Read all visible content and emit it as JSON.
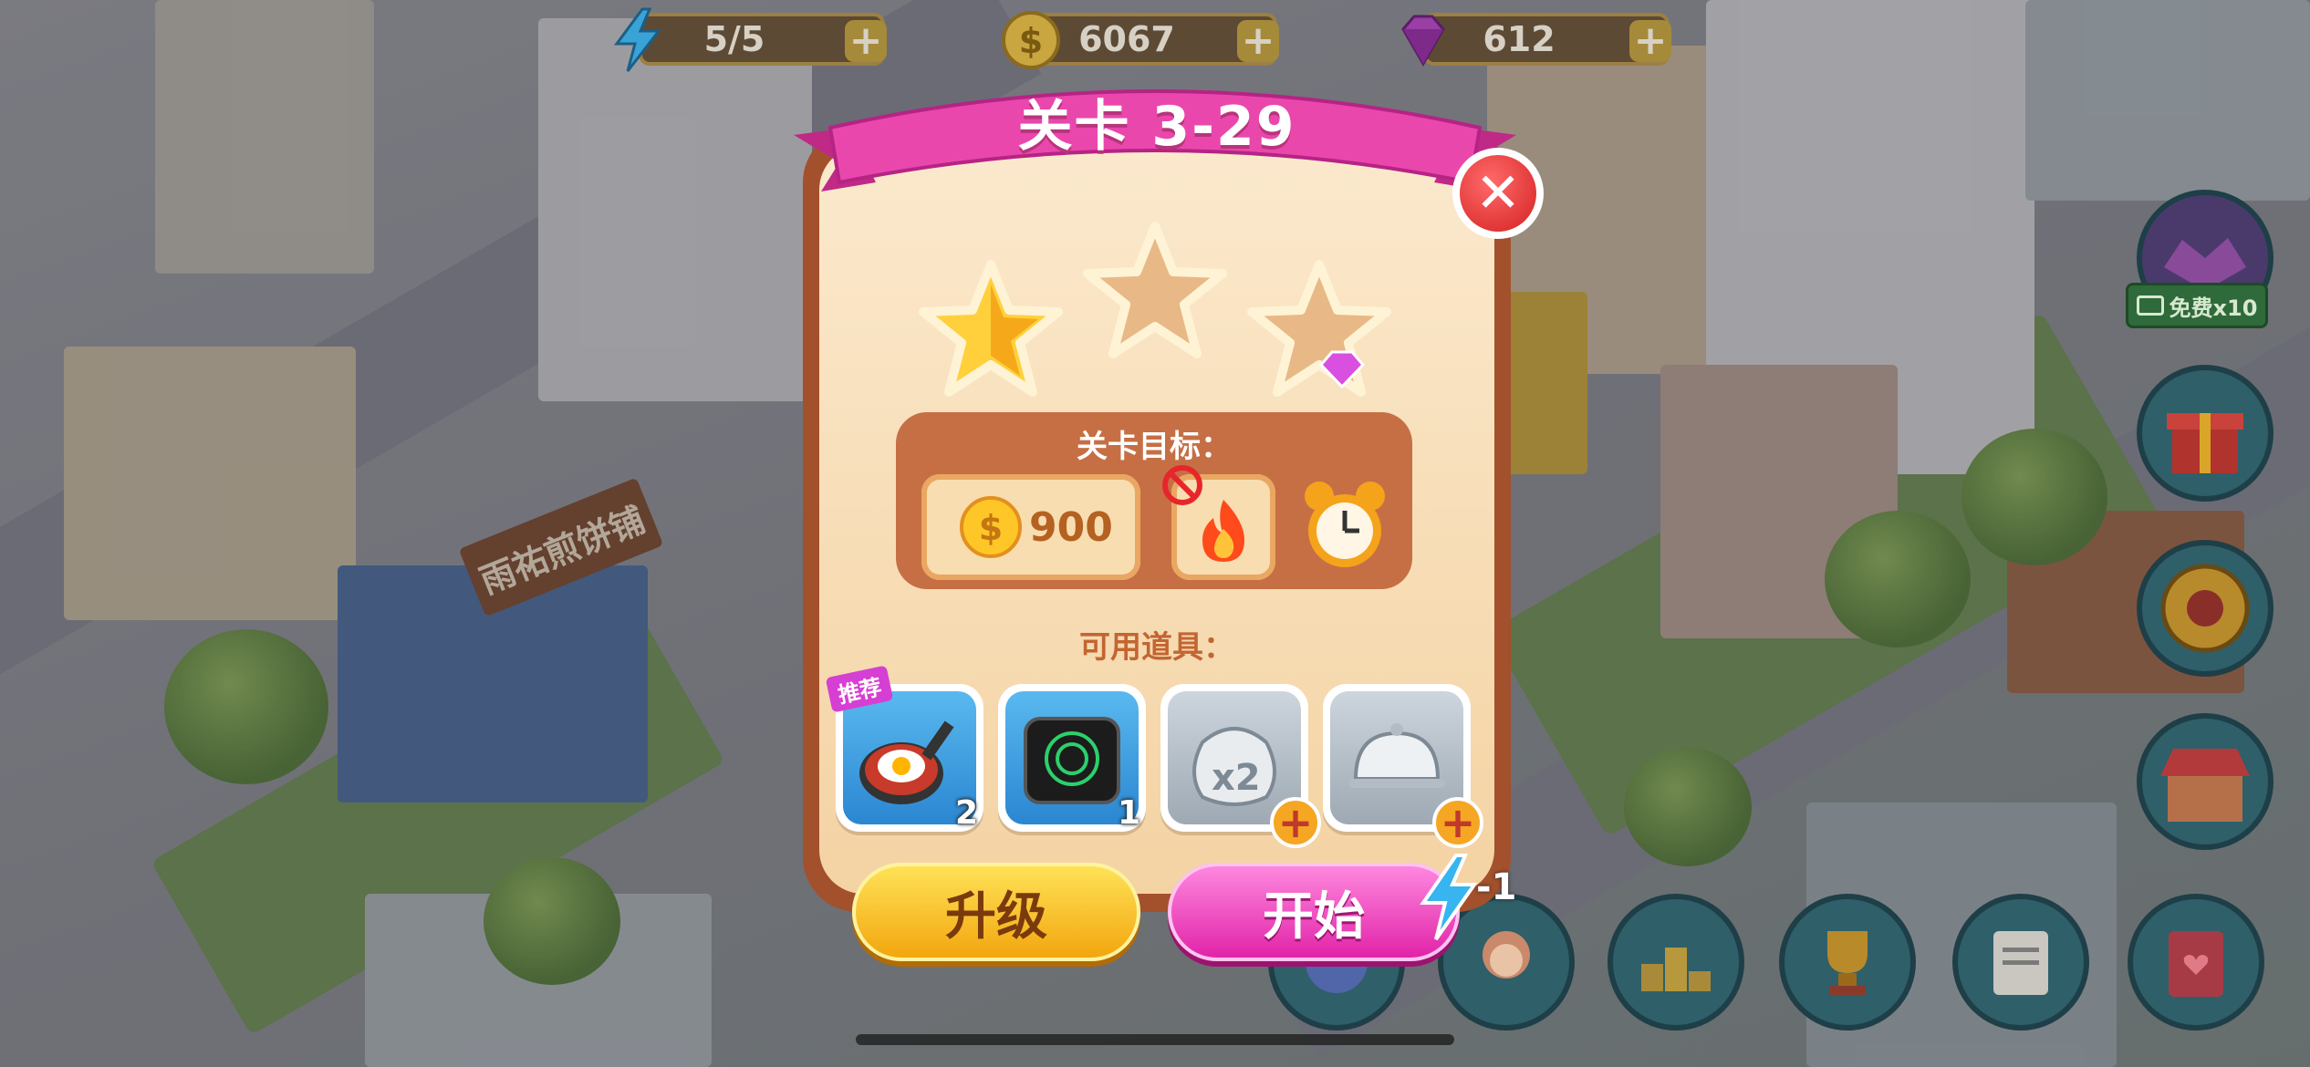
{
  "resources": {
    "energy": "5/5",
    "coins": "6067",
    "gems": "612"
  },
  "background": {
    "shop_sign": "雨祐煎饼铺",
    "sign_fragment": "雨"
  },
  "side": {
    "free_label": "免费x10"
  },
  "dialog": {
    "title": "关卡 3-29",
    "stars_earned": 1,
    "stars_total": 3,
    "goal_title": "关卡目标：",
    "coin_goal": "900",
    "tools_title": "可用道具：",
    "tools": [
      {
        "name": "frying-pan-egg",
        "count": "2",
        "tag": "推荐"
      },
      {
        "name": "induction-cooker",
        "count": "1"
      },
      {
        "name": "double-coins-bag"
      },
      {
        "name": "serving-cloche"
      }
    ],
    "upgrade_label": "升级",
    "start_label": "开始",
    "start_cost": "-1"
  },
  "colors": {
    "ribbon": "#e83aa0",
    "panel_border": "#a3502c",
    "goal_box": "#c66f45",
    "upgrade_button": "#f2a40b",
    "start_button": "#e020a6",
    "close_button": "#d42121"
  }
}
